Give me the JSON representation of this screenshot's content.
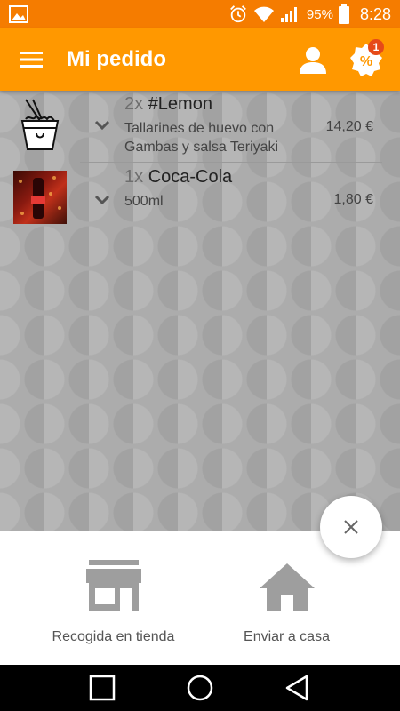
{
  "status_bar": {
    "battery": "95%",
    "time": "8:28"
  },
  "app_bar": {
    "title": "Mi pedido",
    "promo_badge_count": "1"
  },
  "order_items": [
    {
      "quantity": "2x",
      "name": "#Lemon",
      "description_line1": "Tallarines de huevo con",
      "description_line2": "Gambas y salsa Teriyaki",
      "price": "14,20 €",
      "thumbnail": "noodle-box-icon"
    },
    {
      "quantity": "1x",
      "name": "Coca-Cola",
      "description_line1": "500ml",
      "description_line2": "",
      "price": "1,80 €",
      "thumbnail": "coca-cola-photo"
    }
  ],
  "delivery_options": {
    "pickup_label": "Recogida en tienda",
    "delivery_label": "Enviar a casa"
  },
  "colors": {
    "primary": "#ff9800",
    "status_bar": "#f57c00",
    "badge": "#e64a19",
    "content_bg": "#acacac"
  }
}
